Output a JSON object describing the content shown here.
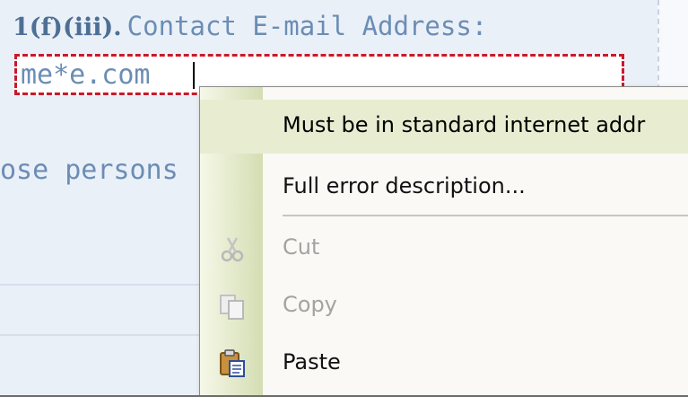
{
  "form": {
    "field_number": "1(f)(iii).",
    "field_label": "Contact E-mail Address:",
    "email_value": "me*e.com",
    "background_text": "ose persons"
  },
  "context_menu": {
    "items": [
      {
        "label": "Must be in standard internet addr",
        "state": "highlighted"
      },
      {
        "label": "Full error description...",
        "state": "enabled"
      },
      {
        "label": "Cut",
        "state": "disabled",
        "icon": "scissors-icon"
      },
      {
        "label": "Copy",
        "state": "disabled",
        "icon": "copy-icon"
      },
      {
        "label": "Paste",
        "state": "enabled",
        "icon": "paste-icon"
      }
    ]
  },
  "colors": {
    "error_border": "#c9192b",
    "label_text": "#6b8db5",
    "menu_highlight": "#e8edd1",
    "disabled_text": "#a3a3a3"
  }
}
